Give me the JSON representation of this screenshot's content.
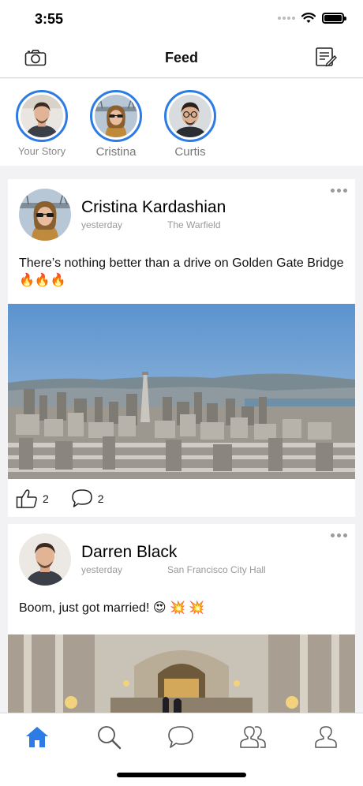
{
  "status_bar": {
    "time": "3:55"
  },
  "nav": {
    "title": "Feed",
    "left_icon": "camera-icon",
    "right_icon": "compose-icon"
  },
  "stories": [
    {
      "label": "Your Story",
      "avatar": "man-avatar"
    },
    {
      "label": "Cristina",
      "avatar": "woman-sunglasses-avatar"
    },
    {
      "label": "Curtis",
      "avatar": "man-glasses-avatar"
    }
  ],
  "posts": [
    {
      "author": "Cristina Kardashian",
      "time": "yesterday",
      "location": "The Warfield",
      "text": "There’s nothing better than a drive on Golden Gate Bridge 🔥🔥🔥",
      "image": "san-francisco-skyline-photo",
      "likes": "2",
      "comments": "2"
    },
    {
      "author": "Darren Black",
      "time": "yesterday",
      "location": "San Francisco City Hall",
      "text": "Boom, just got married! 😍 💥 💥",
      "image": "city-hall-interior-photo"
    }
  ],
  "tab_bar": {
    "tabs": [
      "home-icon",
      "search-icon",
      "chat-icon",
      "friends-icon",
      "profile-icon"
    ],
    "active": "home-icon"
  },
  "colors": {
    "accent": "#2d7be5",
    "background": "#f2f2f4",
    "secondary_text": "#999999"
  }
}
